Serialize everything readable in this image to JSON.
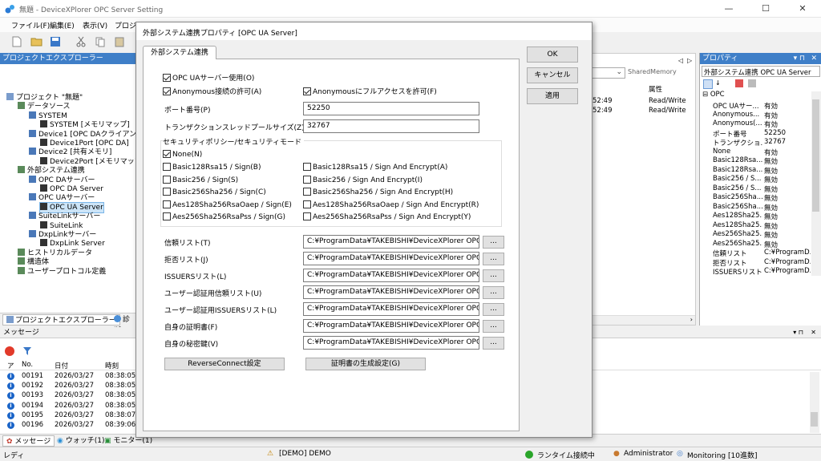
{
  "window": {
    "title": "無題 - DeviceXPlorer OPC Server Setting",
    "minimize": "—",
    "maximize": "☐",
    "close": "✕"
  },
  "menu": [
    "ファイル(F)",
    "編集(E)",
    "表示(V)",
    "プロジェ"
  ],
  "left_panel": {
    "title": "プロジェクトエクスプローラー",
    "tree": [
      {
        "label": "プロジェクト \"無題\"",
        "level": 0
      },
      {
        "label": "データソース",
        "level": 1
      },
      {
        "label": "SYSTEM",
        "level": 2
      },
      {
        "label": "SYSTEM [メモリマップ]",
        "level": 3
      },
      {
        "label": "Device1 [OPC DAクライアント",
        "level": 2
      },
      {
        "label": "Device1Port [OPC DA]",
        "level": 3
      },
      {
        "label": "Device2 [共有メモリ]",
        "level": 2
      },
      {
        "label": "Device2Port [メモリマップ]",
        "level": 3
      },
      {
        "label": "外部システム連携",
        "level": 1
      },
      {
        "label": "OPC DAサーバー",
        "level": 2
      },
      {
        "label": "OPC DA Server",
        "level": 3
      },
      {
        "label": "OPC UAサーバー",
        "level": 2
      },
      {
        "label": "OPC UA Server",
        "level": 3,
        "selected": true
      },
      {
        "label": "SuiteLinkサーバー",
        "level": 2
      },
      {
        "label": "SuiteLink",
        "level": 3
      },
      {
        "label": "DxpLinkサーバー",
        "level": 2
      },
      {
        "label": "DxpLink Server",
        "level": 3
      },
      {
        "label": "ヒストリカルデータ",
        "level": 1
      },
      {
        "label": "構造体",
        "level": 1
      },
      {
        "label": "ユーザープロトコル定義",
        "level": 1
      }
    ],
    "tab_explorer": "プロジェクトエクスプローラー",
    "tab_diag": "診断"
  },
  "mid_panel": {
    "nav_left": "◁",
    "nav_right": "▷",
    "combo_value": "SharedMemory",
    "column_header": "属性",
    "rows": [
      {
        "time": "52:49",
        "attr": "Read/Write"
      },
      {
        "time": "52:49",
        "attr": "Read/Write"
      }
    ]
  },
  "prop_panel": {
    "title": "プロパティ",
    "combo_value": "外部システム連携 OPC UA Server",
    "category": "OPC",
    "rows": [
      {
        "name": "OPC UAサー...",
        "value": "有効"
      },
      {
        "name": "Anonymous...",
        "value": "有効"
      },
      {
        "name": "Anonymous(...",
        "value": "有効"
      },
      {
        "name": "ポート番号",
        "value": "52250"
      },
      {
        "name": "トランザクショ...",
        "value": "32767"
      },
      {
        "name": "None",
        "value": "有効"
      },
      {
        "name": "Basic128Rsa...",
        "value": "無効"
      },
      {
        "name": "Basic128Rsa...",
        "value": "無効"
      },
      {
        "name": "Basic256 / S...",
        "value": "無効"
      },
      {
        "name": "Basic256 / S...",
        "value": "無効"
      },
      {
        "name": "Basic256Sha...",
        "value": "無効"
      },
      {
        "name": "Basic256Sha...",
        "value": "無効"
      },
      {
        "name": "Aes128Sha25...",
        "value": "無効"
      },
      {
        "name": "Aes128Sha25...",
        "value": "無効"
      },
      {
        "name": "Aes256Sha25...",
        "value": "無効"
      },
      {
        "name": "Aes256Sha25...",
        "value": "無効"
      },
      {
        "name": "信頼リスト",
        "value": "C:¥ProgramD..."
      },
      {
        "name": "拒否リスト",
        "value": "C:¥ProgramD..."
      },
      {
        "name": "ISSUERSリスト",
        "value": "C:¥ProgramD..."
      }
    ]
  },
  "messages": {
    "title": "メッセージ",
    "col_type": "ア",
    "col_no": "No.",
    "col_date": "日付",
    "col_time": "時刻",
    "rows": [
      {
        "no": "00191",
        "date": "2026/03/27",
        "time": "08:38:05"
      },
      {
        "no": "00192",
        "date": "2026/03/27",
        "time": "08:38:05"
      },
      {
        "no": "00193",
        "date": "2026/03/27",
        "time": "08:38:05"
      },
      {
        "no": "00194",
        "date": "2026/03/27",
        "time": "08:38:05"
      },
      {
        "no": "00195",
        "date": "2026/03/27",
        "time": "08:38:07"
      },
      {
        "no": "00196",
        "date": "2026/03/27",
        "time": "08:39:06"
      }
    ],
    "tab_messages": "メッセージ",
    "tab_watch": "ウォッチ(1)",
    "tab_monitor": "モニター(1)"
  },
  "status": {
    "ready": "レディ",
    "demo": "[DEMO] DEMO",
    "runtime": "ランタイム接続中",
    "user": "Administrator",
    "monitoring": "Monitoring [10進数]"
  },
  "dialog": {
    "title": "外部システム連携プロパティ [OPC UA Server]",
    "tab": "外部システム連携",
    "ok": "OK",
    "cancel": "キャンセル",
    "apply": "適用",
    "opcua_enable": "OPC UAサーバー使用(O)",
    "anon_allow": "Anonymous接続の許可(A)",
    "anon_full": "Anonymousにフルアクセスを許可(F)",
    "port_label": "ポート番号(P)",
    "port_value": "52250",
    "pool_label": "トランザクションスレッドプールサイズ(Z)",
    "pool_value": "32767",
    "security_label": "セキュリティポリシー/セキュリティモード",
    "none": "None(N)",
    "policies_left": [
      "Basic128Rsa15 / Sign(B)",
      "Basic256 / Sign(S)",
      "Basic256Sha256 / Sign(C)",
      "Aes128Sha256RsaOaep / Sign(E)",
      "Aes256Sha256RsaPss / Sign(G)"
    ],
    "policies_right": [
      "Basic128Rsa15 / Sign And Encrypt(A)",
      "Basic256 / Sign And Encrypt(I)",
      "Basic256Sha256 / Sign And Encrypt(H)",
      "Aes128Sha256RsaOaep / Sign And Encrypt(R)",
      "Aes256Sha256RsaPss / Sign And Encrypt(Y)"
    ],
    "lists": [
      {
        "label": "信頼リスト(T)",
        "value": "C:¥ProgramData¥TAKEBISHI¥DeviceXPlorer OPC Server"
      },
      {
        "label": "拒否リスト(J)",
        "value": "C:¥ProgramData¥TAKEBISHI¥DeviceXPlorer OPC Server"
      },
      {
        "label": "ISSUERSリスト(L)",
        "value": "C:¥ProgramData¥TAKEBISHI¥DeviceXPlorer OPC Server"
      },
      {
        "label": "ユーザー認証用信頼リスト(U)",
        "value": "C:¥ProgramData¥TAKEBISHI¥DeviceXPlorer OPC Server"
      },
      {
        "label": "ユーザー認証用ISSUERSリスト(L)",
        "value": "C:¥ProgramData¥TAKEBISHI¥DeviceXPlorer OPC Server"
      },
      {
        "label": "自身の証明書(F)",
        "value": "C:¥ProgramData¥TAKEBISHI¥DeviceXPlorer OPC Server"
      },
      {
        "label": "自身の秘密鍵(V)",
        "value": "C:¥ProgramData¥TAKEBISHI¥DeviceXPlorer OPC Server"
      }
    ],
    "browse": "...",
    "reverse_connect": "ReverseConnect設定",
    "cert_gen": "証明書の生成設定(G)"
  },
  "colors": {
    "panel_header": "#3f7fc8",
    "selection": "#0078d7",
    "info": "#1a64c8"
  }
}
